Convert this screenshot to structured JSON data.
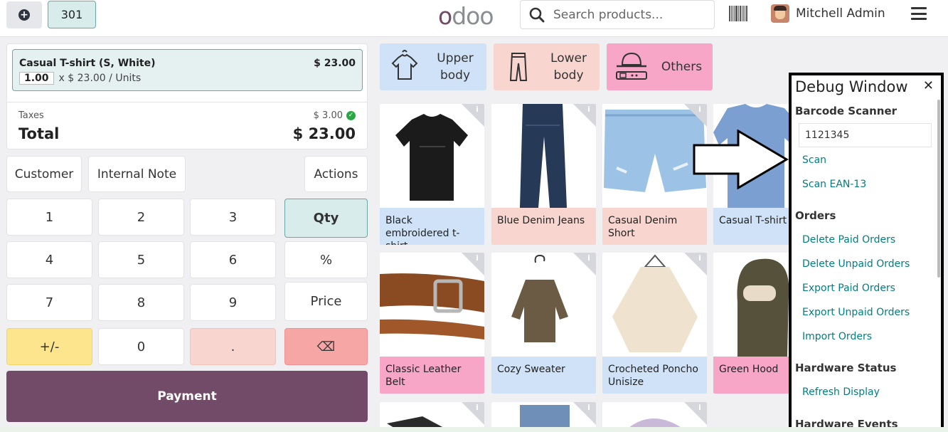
{
  "header": {
    "table_number": "301",
    "logo": "odoo",
    "search_placeholder": "Search products...",
    "user_name": "Mitchell Admin"
  },
  "order": {
    "line": {
      "name": "Casual T-shirt (S, White)",
      "price": "$ 23.00",
      "qty": "1.00",
      "unit_text": "x $ 23.00 / Units"
    },
    "taxes_label": "Taxes",
    "taxes_value": "$ 3.00",
    "total_label": "Total",
    "total_value": "$ 23.00"
  },
  "controls": {
    "customer": "Customer",
    "internal_note": "Internal Note",
    "actions": "Actions"
  },
  "numpad": {
    "k1": "1",
    "k2": "2",
    "k3": "3",
    "k4": "4",
    "k5": "5",
    "k6": "6",
    "k7": "7",
    "k8": "8",
    "k9": "9",
    "sign": "+/-",
    "k0": "0",
    "dot": ".",
    "backspace": "⌫",
    "qty": "Qty",
    "percent": "%",
    "price": "Price"
  },
  "payment_label": "Payment",
  "categories": [
    {
      "label": "Upper body",
      "color": "#cfe2f7"
    },
    {
      "label": "Lower body",
      "color": "#f8d6cf"
    },
    {
      "label": "Others",
      "color": "#f7a6c8"
    }
  ],
  "products": [
    {
      "name": "Black embroidered t-shirt",
      "color": "#cfe2f7"
    },
    {
      "name": "Blue Denim Jeans",
      "color": "#f8d6cf"
    },
    {
      "name": "Casual Denim Short",
      "color": "#f8d6cf"
    },
    {
      "name": "Casual T-shirt",
      "color": "#cfe2f7"
    },
    {
      "name": "Classic Leather Belt",
      "color": "#f7a6c8"
    },
    {
      "name": "Cozy Sweater",
      "color": "#cfe2f7"
    },
    {
      "name": "Crocheted Poncho Unisize",
      "color": "#cfe2f7"
    },
    {
      "name": "Green Hood",
      "color": "#f7a6c8"
    }
  ],
  "debug": {
    "title": "Debug Window",
    "barcode_heading": "Barcode Scanner",
    "barcode_value": "1121345",
    "scan": "Scan",
    "scan_ean": "Scan EAN-13",
    "orders_heading": "Orders",
    "delete_paid": "Delete Paid Orders",
    "delete_unpaid": "Delete Unpaid Orders",
    "export_paid": "Export Paid Orders",
    "export_unpaid": "Export Unpaid Orders",
    "import_orders": "Import Orders",
    "hardware_status_heading": "Hardware Status",
    "refresh_display": "Refresh Display",
    "hardware_events_heading": "Hardware Events"
  },
  "colors": {
    "brand": "#714b67",
    "accent": "#017e84",
    "selected": "#d9ecec"
  }
}
